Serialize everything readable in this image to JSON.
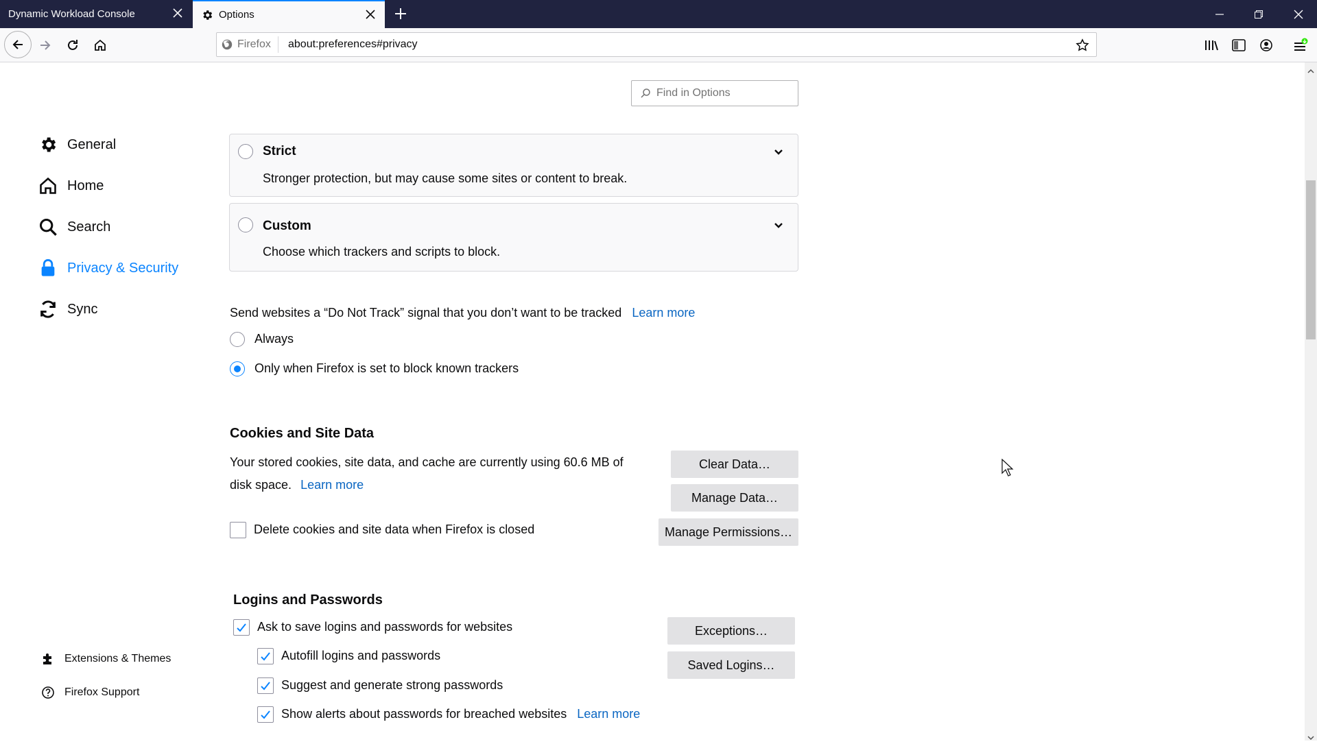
{
  "tabs": [
    {
      "title": "Dynamic Workload Console"
    },
    {
      "title": "Options"
    }
  ],
  "toolbar": {
    "identity_label": "Firefox",
    "url": "about:preferences#privacy"
  },
  "search": {
    "placeholder": "Find in Options"
  },
  "sidebar": {
    "items": [
      {
        "label": "General",
        "icon": "gear-icon"
      },
      {
        "label": "Home",
        "icon": "home-icon"
      },
      {
        "label": "Search",
        "icon": "search-icon"
      },
      {
        "label": "Privacy & Security",
        "icon": "lock-icon",
        "selected": true
      },
      {
        "label": "Sync",
        "icon": "sync-icon"
      }
    ],
    "footer": [
      {
        "label": "Extensions & Themes",
        "icon": "puzzle-icon"
      },
      {
        "label": "Firefox Support",
        "icon": "help-icon"
      }
    ]
  },
  "tracking": {
    "strict": {
      "title": "Strict",
      "desc": "Stronger protection, but may cause some sites or content to break."
    },
    "custom": {
      "title": "Custom",
      "desc": "Choose which trackers and scripts to block."
    }
  },
  "dnt": {
    "label": "Send websites a “Do Not Track” signal that you don’t want to be tracked",
    "learn_more": "Learn more",
    "options": [
      "Always",
      "Only when Firefox is set to block known trackers"
    ],
    "selected_index": 1
  },
  "cookies": {
    "heading": "Cookies and Site Data",
    "usage_line1": "Your stored cookies, site data, and cache are currently using 60.6 MB of",
    "usage_line2": "disk space.",
    "learn_more": "Learn more",
    "delete_label": "Delete cookies and site data when Firefox is closed",
    "delete_checked": false,
    "clear_button": "Clear Data…",
    "manage_button": "Manage Data…",
    "permissions_button": "Manage Permissions…"
  },
  "logins": {
    "heading": "Logins and Passwords",
    "ask_label": "Ask to save logins and passwords for websites",
    "autofill_label": "Autofill logins and passwords",
    "suggest_label": "Suggest and generate strong passwords",
    "alerts_label": "Show alerts about passwords for breached websites",
    "learn_more": "Learn more",
    "exceptions_button": "Exceptions…",
    "saved_button": "Saved Logins…"
  },
  "colors": {
    "accent": "#0a84ff",
    "link": "#0a66c2",
    "tabstrip": "#202340"
  }
}
